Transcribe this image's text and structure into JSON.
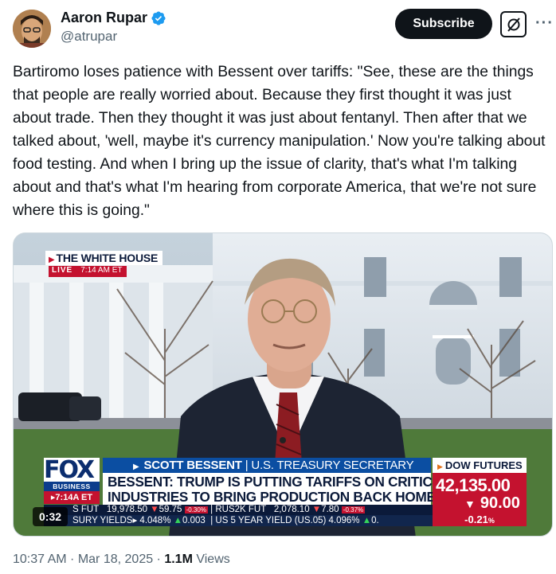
{
  "author": {
    "display_name": "Aaron Rupar",
    "handle": "@atrupar",
    "verified": true,
    "avatar_icon": "avatar-photo"
  },
  "actions": {
    "subscribe_label": "Subscribe",
    "grok_icon": "grok-icon",
    "more_icon": "more-icon",
    "more_glyph": "···"
  },
  "tweet": {
    "text": "Bartiromo loses patience with Bessent over tariffs: \"See, these are the things that people are really worried about. Because they first thought it was just about trade. Then they thought it was just about fentanyl. Then after that we talked about, 'well, maybe it's currency manipulation.' Now you're talking about food testing. And when I bring up the issue of clarity, that's what I'm talking about and that's what I'm hearing from corporate America, that we're not sure where this is going.\""
  },
  "video": {
    "duration": "0:32",
    "location_label": "THE WHITE HOUSE",
    "live_label": "LIVE",
    "live_time": "7:14 AM ET",
    "network_logo": "FOX",
    "network_sub": "BUSINESS",
    "network_time": "7:14A ET",
    "guest_name": "SCOTT BESSENT",
    "guest_title": "U.S. TREASURY SECRETARY",
    "headline_line1": "BESSENT: TRUMP IS PUTTING TARIFFS ON CRITICAL",
    "headline_line2": "INDUSTRIES TO BRING PRODUCTION BACK HOME",
    "dow_label": "DOW FUTURES",
    "dow_value": "42,135.00",
    "dow_change": "90.00",
    "dow_pct": "-0.21",
    "dow_pct_unit": "%",
    "ticker_row1": {
      "a_label": "S FUT",
      "a_value": "19,978.50",
      "a_change": "59.75",
      "a_pct": "-0.30%",
      "b_label": "RUS2K FUT",
      "b_value": "2,078.10",
      "b_change": "7.80",
      "b_pct": "-0.37%"
    },
    "ticker_row2": {
      "a_label": "SURY YIELDS",
      "a_value": "4.048%",
      "a_change": "0.003",
      "b_label": "US 5 YEAR YIELD",
      "b_symbol": "(US.05)",
      "b_value": "4.096%",
      "b_change": "0."
    }
  },
  "meta": {
    "time": "10:37 AM",
    "date": "Mar 18, 2025",
    "views_count": "1.1M",
    "views_label": "Views"
  },
  "colors": {
    "brand_dark": "#0f1419",
    "muted": "#536471",
    "verified_blue": "#1d9bf0",
    "fox_red": "#c4122f",
    "fox_blue": "#0b4ea2"
  }
}
